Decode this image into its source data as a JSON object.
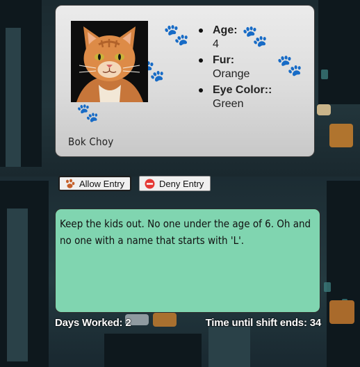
{
  "cat": {
    "name": "Bok Choy",
    "photo_icon": "orange-tabby-cat-photo",
    "attributes": [
      {
        "label": "Age:",
        "value": "4"
      },
      {
        "label": "Fur:",
        "value": "Orange"
      },
      {
        "label": "Eye Color::",
        "value": "Green"
      }
    ]
  },
  "actions": {
    "allow_label": "Allow Entry",
    "allow_icon": "paw-icon",
    "deny_label": "Deny Entry",
    "deny_icon": "no-entry-icon"
  },
  "rules": {
    "text": "Keep the kids out. No one under the age of 6. Oh and no one with a name that starts with 'L'."
  },
  "status": {
    "days_worked": "Days Worked: 2",
    "time_left": "Time until shift ends: 34"
  },
  "colors": {
    "card_bg": "#dcdcdc",
    "rules_bg": "#80d5b0",
    "background": "#1b2a30",
    "status_text": "#ffffff"
  }
}
